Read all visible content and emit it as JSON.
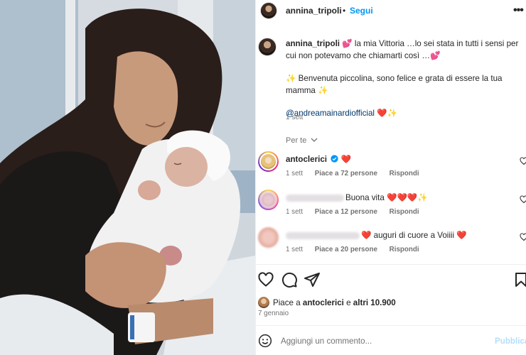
{
  "post": {
    "author": "annina_tripoli",
    "dot": "•",
    "follow_label": "Segui",
    "more_icon": "more-horizontal-icon"
  },
  "caption": {
    "username": "annina_tripoli",
    "line1": " 💕 la mia Vittoria …lo sei stata in tutti i sensi per cui non potevamo che chiamarti così …💕",
    "line2": "✨ Benvenuta piccolina, sono felice e grata di essere la tua mamma ✨",
    "mention": "@andreamainardiofficial",
    "mention_suffix": " ❤️✨",
    "time": "1 sett"
  },
  "sort": {
    "label": "Per te"
  },
  "comments": [
    {
      "username": "antoclerici",
      "verified": true,
      "text": " ❤️",
      "time": "1 sett",
      "likes": "Piace a 72 persone",
      "reply": "Rispondi"
    },
    {
      "username": "",
      "text": "Buona vita ❤️❤️❤️✨",
      "time": "1 sett",
      "likes": "Piace a 12 persone",
      "reply": "Rispondi"
    },
    {
      "username": "",
      "text": "❤️ auguri di cuore a Voiiii ❤️",
      "time": "1 sett",
      "likes": "Piace a 20 persone",
      "reply": "Rispondi"
    }
  ],
  "likes": {
    "prefix": "Piace a ",
    "user": "antoclerici",
    "middle": " e ",
    "others": "altri 10.900"
  },
  "date": "7 gennaio",
  "composer": {
    "placeholder": "Aggiungi un commento...",
    "publish": "Pubblica"
  },
  "colors": {
    "accent": "#0095f6",
    "mention": "#00376b",
    "muted": "#737373",
    "heart": "#ed4956"
  }
}
